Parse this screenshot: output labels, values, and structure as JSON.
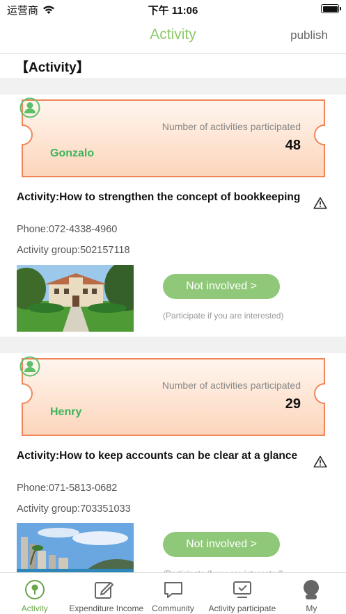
{
  "status_bar": {
    "carrier": "运营商",
    "time": "下午 11:06"
  },
  "nav": {
    "title": "Activity",
    "publish_label": "publish"
  },
  "section_title": "【Activity】",
  "count_label": "Number of activities participated",
  "activities": [
    {
      "user": "Gonzalo",
      "count": "48",
      "title": "Activity:How to strengthen the concept of bookkeeping",
      "phone": "Phone:072-4338-4960",
      "group": "Activity group:502157118",
      "button": "Not involved >",
      "hint": "(Participate if you are interested)"
    },
    {
      "user": "Henry",
      "count": "29",
      "title": "Activity:How to keep accounts can be clear at a glance",
      "phone": "Phone:071-5813-0682",
      "group": "Activity group:703351033",
      "button": "Not involved >",
      "hint": "(Participate if you are interested)"
    }
  ],
  "tabs": [
    {
      "label": "Activity",
      "icon": "activity-icon",
      "active": true
    },
    {
      "label": "Expenditure Income",
      "icon": "edit-icon"
    },
    {
      "label": "Community",
      "icon": "chat-icon"
    },
    {
      "label": "Activity participate",
      "icon": "check-icon"
    },
    {
      "label": "My",
      "icon": "profile-icon"
    }
  ],
  "colors": {
    "accent": "#8ec96b",
    "button": "#8fc878",
    "username": "#3cb55a",
    "ticket_border": "#f0855a",
    "ticket_fill": "#fde6d6"
  }
}
